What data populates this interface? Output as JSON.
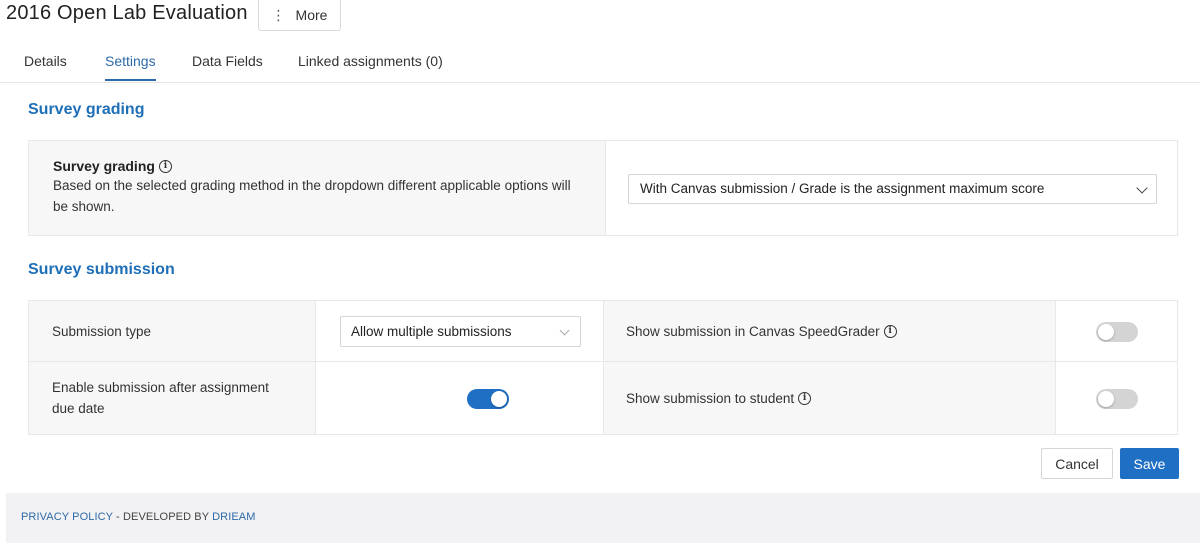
{
  "header": {
    "title": "2016 Open Lab Evaluation",
    "more_label": "More",
    "more_icon": "⋮"
  },
  "tabs": [
    {
      "label": "Details",
      "active": false
    },
    {
      "label": "Settings",
      "active": true
    },
    {
      "label": "Data Fields",
      "active": false
    },
    {
      "label": "Linked assignments (0)",
      "active": false
    }
  ],
  "grading": {
    "section_title": "Survey grading",
    "label": "Survey grading",
    "description": "Based on the selected grading method in the dropdown different applicable options will be shown.",
    "selected_option": "With Canvas submission / Grade is the assignment maximum score"
  },
  "submission": {
    "section_title": "Survey submission",
    "submission_type_label": "Submission type",
    "submission_type_value": "Allow multiple submissions",
    "speedgrader_label": "Show submission in Canvas SpeedGrader",
    "speedgrader_enabled": false,
    "after_due_label": "Enable submission after assignment due date",
    "after_due_enabled": true,
    "to_student_label": "Show submission to student",
    "to_student_enabled": false
  },
  "actions": {
    "cancel_label": "Cancel",
    "save_label": "Save"
  },
  "footer": {
    "privacy_label": "PRIVACY POLICY",
    "separator": " - DEVELOPED BY ",
    "developer_label": "DRIEAM"
  },
  "colors": {
    "accent": "#1f6fc4",
    "section_title": "#1f6fb8",
    "toggle_off": "#d4d4d4"
  }
}
